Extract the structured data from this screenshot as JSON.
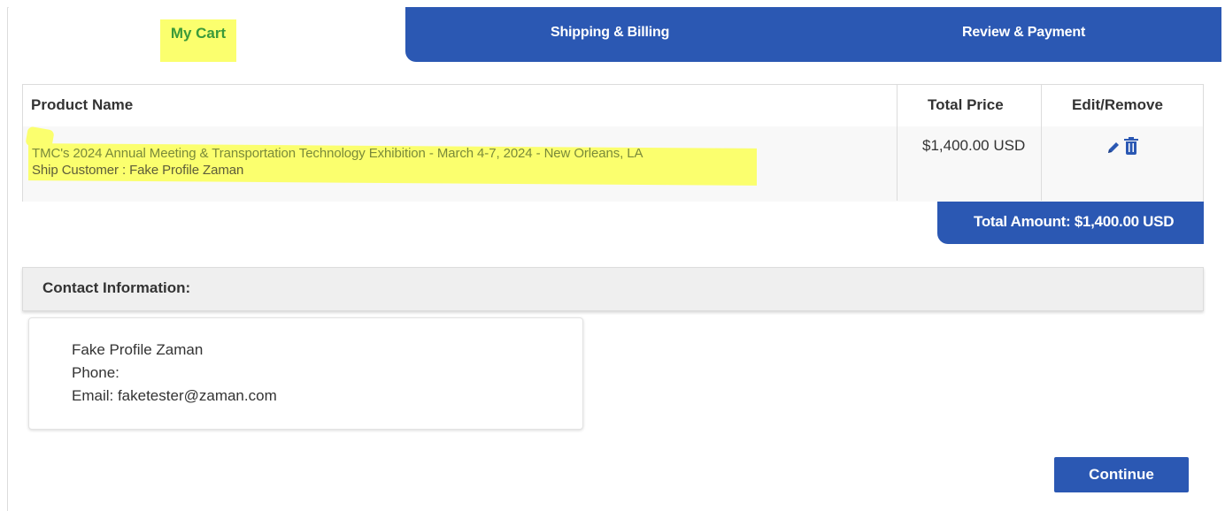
{
  "tabs": [
    {
      "label": "My Cart",
      "active": true
    },
    {
      "label": "Shipping & Billing",
      "active": false
    },
    {
      "label": "Review & Payment",
      "active": false
    }
  ],
  "cart": {
    "headers": {
      "product_name": "Product Name",
      "total_price": "Total Price",
      "edit_remove": "Edit/Remove"
    },
    "items": [
      {
        "title": "TMC's 2024 Annual Meeting & Transportation Technology Exhibition - March 4-7, 2024 - New Orleans, LA",
        "customer": "Ship Customer : Fake Profile Zaman",
        "price": "$1,400.00 USD",
        "icons": [
          "pencil-icon",
          "trash-icon"
        ]
      }
    ],
    "total_label": "Total Amount: $1,400.00 USD"
  },
  "contact": {
    "header": "Contact Information:",
    "name": "Fake Profile Zaman",
    "phone": "Phone:",
    "email": "Email: faketester@zaman.com"
  },
  "actions": {
    "continue_label": "Continue"
  },
  "colors": {
    "primary_blue": "#2b58b3",
    "highlight_yellow": "#fbff6e",
    "active_tab_text": "#3a9a3a"
  }
}
